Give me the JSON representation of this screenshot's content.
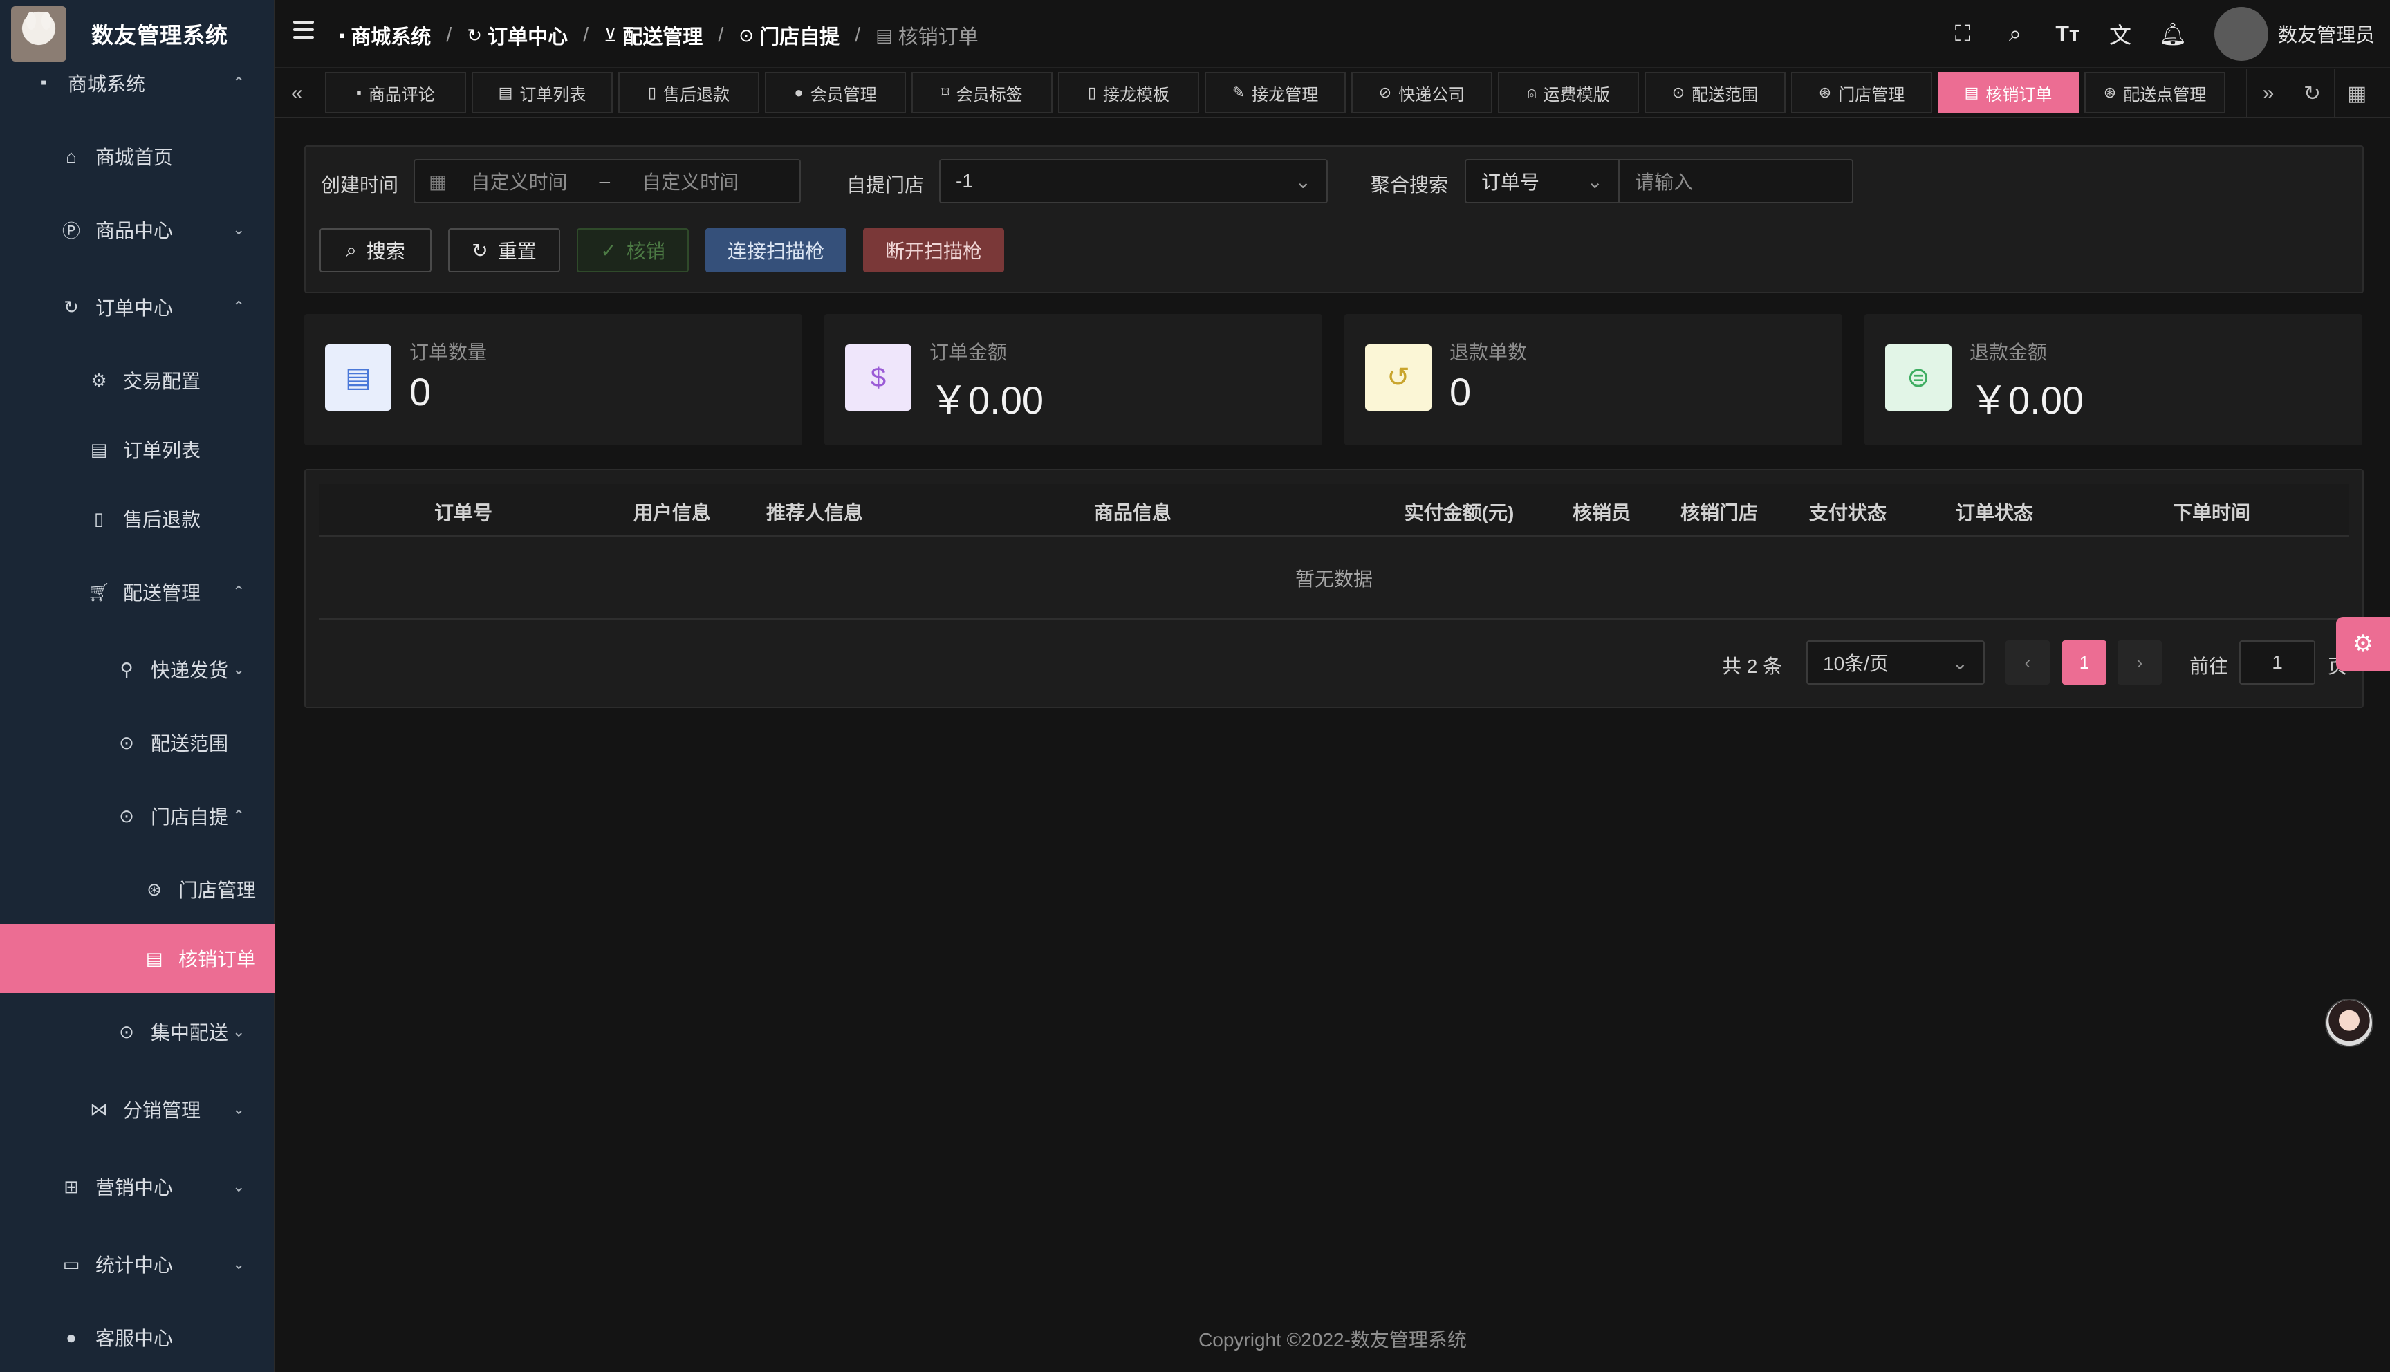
{
  "app": {
    "title": "数友管理系统"
  },
  "sidebar": {
    "top": {
      "label": "商城系统",
      "icon": "store-icon"
    },
    "items": [
      {
        "label": "商城首页",
        "icon": "home-icon"
      },
      {
        "label": "商品中心",
        "icon": "product-icon"
      },
      {
        "label": "订单中心",
        "icon": "order-icon"
      },
      {
        "label": "交易配置",
        "icon": "gear-icon"
      },
      {
        "label": "订单列表",
        "icon": "clipboard-icon"
      },
      {
        "label": "售后退款",
        "icon": "refund-icon"
      },
      {
        "label": "配送管理",
        "icon": "cart-icon"
      },
      {
        "label": "快递发货",
        "icon": "bicycle-icon"
      },
      {
        "label": "配送范围",
        "icon": "location-icon"
      },
      {
        "label": "门店自提",
        "icon": "location-icon"
      },
      {
        "label": "门店管理",
        "icon": "store-manage-icon"
      },
      {
        "label": "核销订单",
        "icon": "clipboard-icon"
      },
      {
        "label": "集中配送",
        "icon": "location-icon"
      },
      {
        "label": "分销管理",
        "icon": "share-icon"
      },
      {
        "label": "营销中心",
        "icon": "gift-icon"
      },
      {
        "label": "统计中心",
        "icon": "chart-icon"
      },
      {
        "label": "客服中心",
        "icon": "user-icon"
      }
    ]
  },
  "breadcrumb": [
    "商城系统",
    "订单中心",
    "配送管理",
    "门店自提",
    "核销订单"
  ],
  "header": {
    "username": "数友管理员"
  },
  "tabs": [
    "商品评论",
    "订单列表",
    "售后退款",
    "会员管理",
    "会员标签",
    "接龙模板",
    "接龙管理",
    "快递公司",
    "运费模版",
    "配送范围",
    "门店管理",
    "核销订单",
    "配送点管理"
  ],
  "filters": {
    "created_time_label": "创建时间",
    "start_placeholder": "自定义时间",
    "range_sep": "–",
    "end_placeholder": "自定义时间",
    "store_label": "自提门店",
    "store_value": "-1",
    "search_label": "聚合搜索",
    "search_type": "订单号",
    "search_placeholder": "请输入",
    "btn_search": "搜索",
    "btn_reset": "重置",
    "btn_verify": "核销",
    "btn_connect": "连接扫描枪",
    "btn_disconnect": "断开扫描枪"
  },
  "stats": [
    {
      "label": "订单数量",
      "value": "0",
      "icon": "clipboard-icon",
      "bg": "#e8eefc",
      "fg": "#4a78d8"
    },
    {
      "label": "订单金额",
      "value": "￥0.00",
      "icon": "invoice-icon",
      "bg": "#efe6fb",
      "fg": "#9a5bd6"
    },
    {
      "label": "退款单数",
      "value": "0",
      "icon": "refund-doc-icon",
      "bg": "#fbf6d6",
      "fg": "#c9a52e"
    },
    {
      "label": "退款金额",
      "value": "￥0.00",
      "icon": "money-icon",
      "bg": "#e2f5e7",
      "fg": "#3fae62"
    }
  ],
  "table": {
    "columns": [
      "订单号",
      "用户信息",
      "推荐人信息",
      "商品信息",
      "实付金额(元)",
      "核销员",
      "核销门店",
      "支付状态",
      "订单状态",
      "下单时间"
    ],
    "empty_text": "暂无数据"
  },
  "pagination": {
    "total_text": "共 2 条",
    "page_size": "10条/页",
    "current_page": "1",
    "goto_label": "前往",
    "goto_value": "1",
    "page_suffix": "页"
  },
  "footer": "Copyright ©2022-数友管理系统",
  "colors": {
    "accent": "#ec6d93",
    "sidebar_bg": "#1a2635",
    "bg": "#141414"
  }
}
